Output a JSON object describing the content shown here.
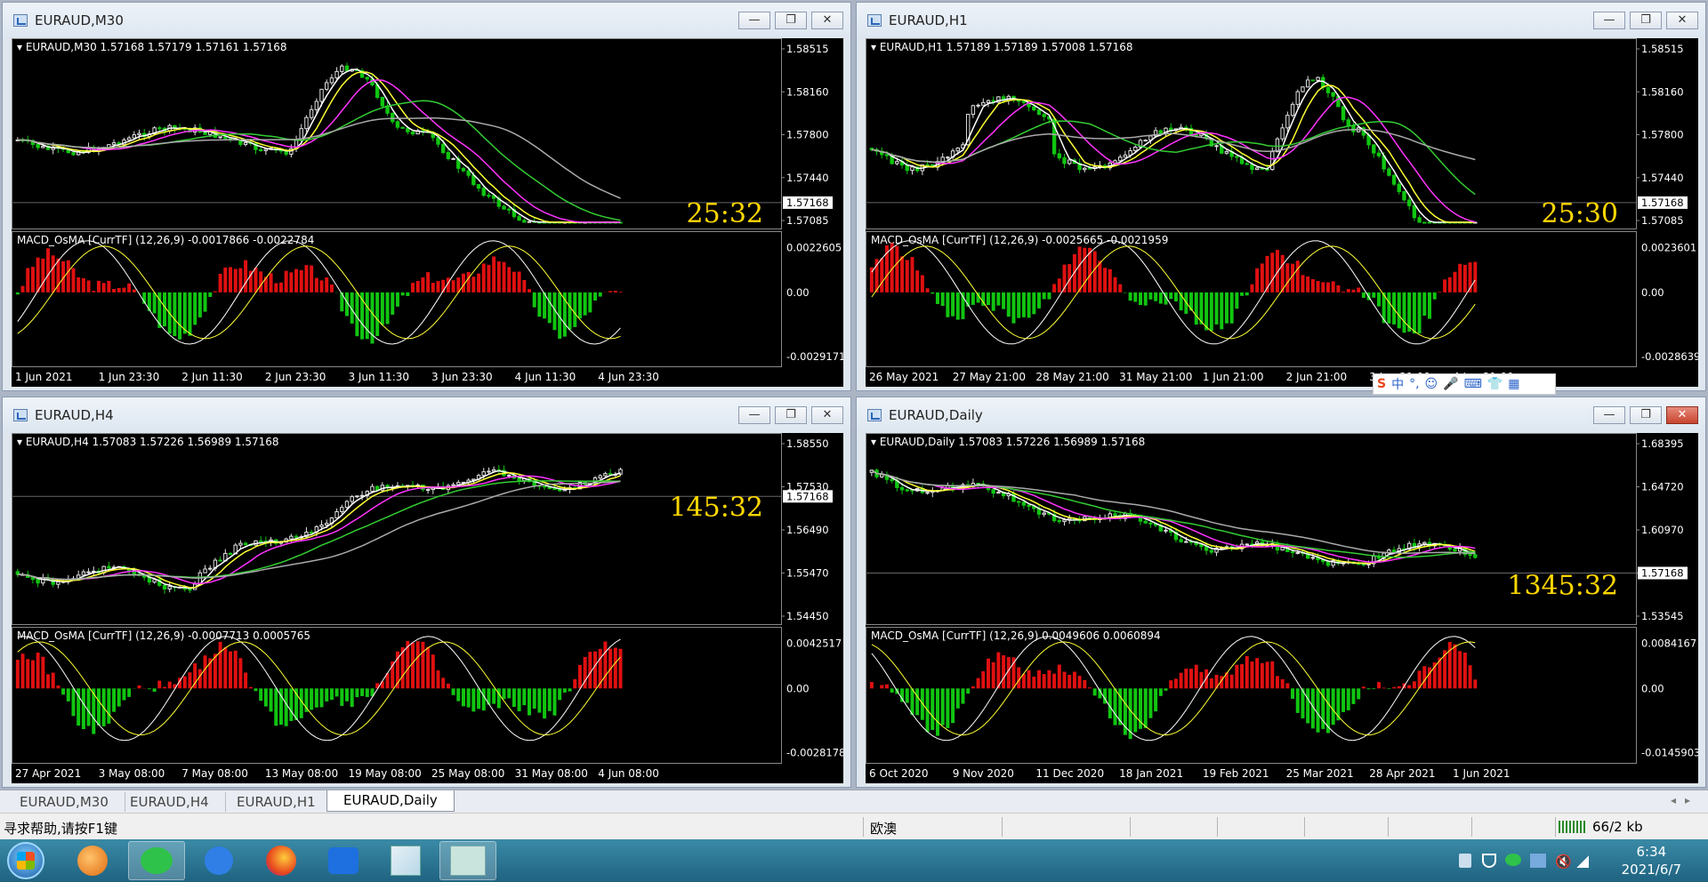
{
  "windows": [
    {
      "id": "m30",
      "title": "EURAUD,M30",
      "info": "EURAUD,M30  1.57168 1.57179 1.57161 1.57168",
      "prices": [
        "1.58515",
        "1.58160",
        "1.57800",
        "1.57440",
        "1.57085"
      ],
      "current": "1.57168",
      "macd_info": "MACD_OsMA [CurrTF] (12,26,9) -0.0017866 -0.0022784",
      "macd_scale": [
        "0.0022605",
        "0.00",
        "-0.0029171"
      ],
      "timer": "25:32",
      "xlabels": [
        "1 Jun 2021",
        "1 Jun 23:30",
        "2 Jun 11:30",
        "2 Jun 23:30",
        "3 Jun 11:30",
        "3 Jun 23:30",
        "4 Jun 11:30",
        "4 Jun 23:30"
      ]
    },
    {
      "id": "h1",
      "title": "EURAUD,H1",
      "info": "EURAUD,H1  1.57189 1.57189 1.57008 1.57168",
      "prices": [
        "1.58515",
        "1.58160",
        "1.57800",
        "1.57440",
        "1.57085"
      ],
      "current": "1.57168",
      "macd_info": "MACD_OsMA [CurrTF] (12,26,9) -0.0025665 -0.0021959",
      "macd_scale": [
        "0.0023601",
        "0.00",
        "-0.0028639"
      ],
      "timer": "25:30",
      "xlabels": [
        "26 May 2021",
        "27 May 21:00",
        "28 May 21:00",
        "31 May 21:00",
        "1 Jun 21:00",
        "2 Jun 21:00",
        "3 Jun 21:00",
        "4 Jun 21:00"
      ]
    },
    {
      "id": "h4",
      "title": "EURAUD,H4",
      "info": "EURAUD,H4  1.57083 1.57226 1.56989 1.57168",
      "prices": [
        "1.58550",
        "1.57530",
        "1.56490",
        "1.55470",
        "1.54450"
      ],
      "current": "1.57168",
      "macd_info": "MACD_OsMA [CurrTF] (12,26,9) -0.0007713 0.0005765",
      "macd_scale": [
        "0.0042517",
        "0.00",
        "-0.0028178"
      ],
      "timer": "145:32",
      "xlabels": [
        "27 Apr 2021",
        "3 May 08:00",
        "7 May 08:00",
        "13 May 08:00",
        "19 May 08:00",
        "25 May 08:00",
        "31 May 08:00",
        "4 Jun 08:00"
      ]
    },
    {
      "id": "d1",
      "title": "EURAUD,Daily",
      "info": "EURAUD,Daily  1.57083 1.57226 1.56989 1.57168",
      "prices": [
        "1.68395",
        "1.64720",
        "1.60970",
        "1.57168",
        "1.53545"
      ],
      "current": "1.57168",
      "macd_info": "MACD_OsMA [CurrTF] (12,26,9) 0.0049606 0.0060894",
      "macd_scale": [
        "0.0084167",
        "0.00",
        "-0.0145903"
      ],
      "timer": "1345:32",
      "xlabels": [
        "6 Oct 2020",
        "9 Nov 2020",
        "11 Dec 2020",
        "18 Jan 2021",
        "19 Feb 2021",
        "25 Mar 2021",
        "28 Apr 2021",
        "1 Jun 2021"
      ]
    }
  ],
  "window_buttons": {
    "minimize": "—",
    "maximize": "❐",
    "close": "✕"
  },
  "tabs": [
    "EURAUD,M30",
    "EURAUD,H4",
    "EURAUD,H1",
    "EURAUD,Daily"
  ],
  "active_tab": "EURAUD,Daily",
  "ime": {
    "logo": "S",
    "lang": "中"
  },
  "status": {
    "help": "寻求帮助,请按F1键",
    "symbol": "欧澳",
    "traffic": "66/2 kb"
  },
  "clock": {
    "time": "6:34",
    "date": "2021/6/7"
  },
  "colors": {
    "bull": "#e0e0e0",
    "bear": "#11c511",
    "macd_up": "#e01010",
    "macd_down": "#11c511",
    "timer": "#ffd700"
  }
}
